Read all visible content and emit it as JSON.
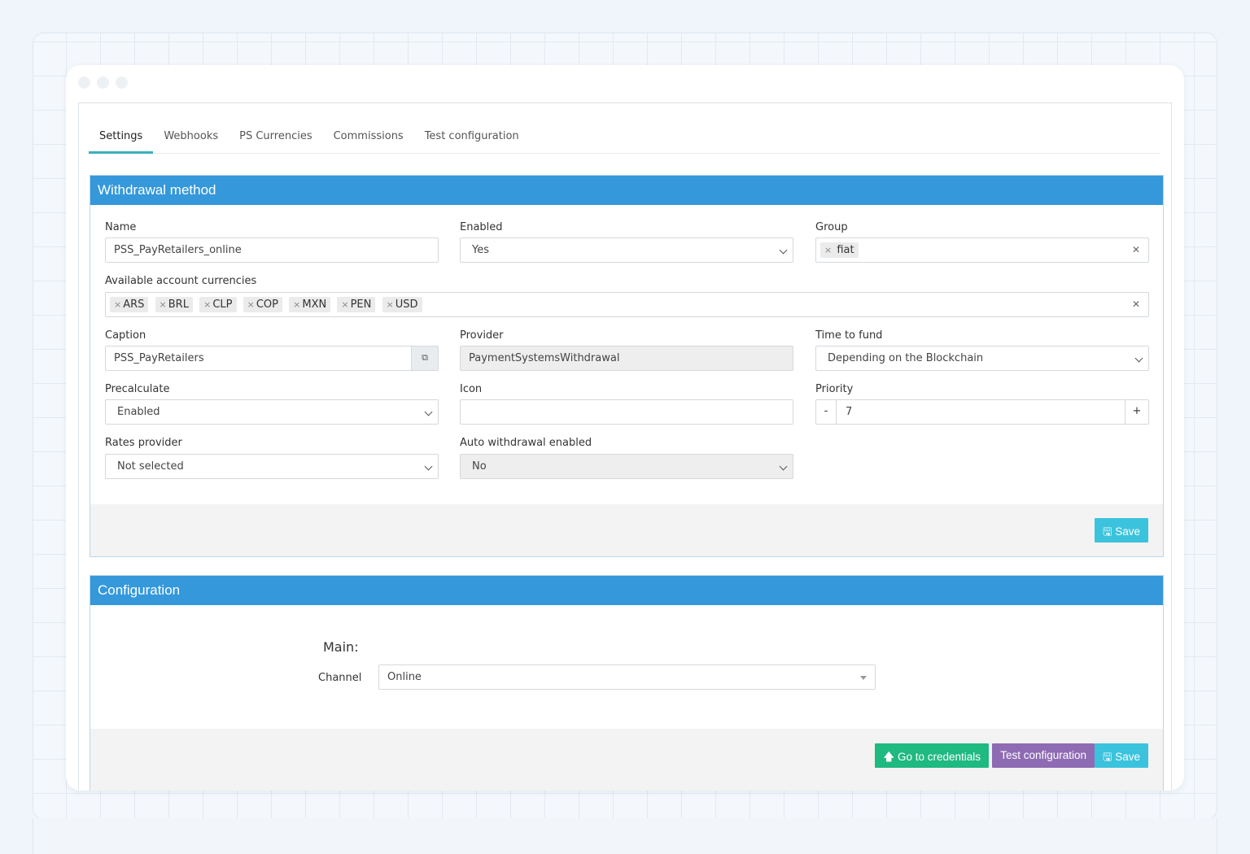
{
  "tabs": [
    {
      "label": "Settings"
    },
    {
      "label": "Webhooks"
    },
    {
      "label": "PS Currencies"
    },
    {
      "label": "Commissions"
    },
    {
      "label": "Test configuration"
    }
  ],
  "withdrawal": {
    "title": "Withdrawal method",
    "name_label": "Name",
    "name_value": "PSS_PayRetailers_online",
    "enabled_label": "Enabled",
    "enabled_value": "Yes",
    "group_label": "Group",
    "group_tags": [
      "fiat"
    ],
    "currencies_label": "Available account currencies",
    "currency_tags": [
      "ARS",
      "BRL",
      "CLP",
      "COP",
      "MXN",
      "PEN",
      "USD"
    ],
    "caption_label": "Caption",
    "caption_value": "PSS_PayRetailers",
    "provider_label": "Provider",
    "provider_value": "PaymentSystemsWithdrawal",
    "time_to_fund_label": "Time to fund",
    "time_to_fund_value": "Depending on the Blockchain",
    "precalculate_label": "Precalculate",
    "precalculate_value": "Enabled",
    "icon_label": "Icon",
    "icon_value": "",
    "priority_label": "Priority",
    "priority_value": "7",
    "priority_minus": "-",
    "priority_plus": "+",
    "rates_label": "Rates provider",
    "rates_value": "Not selected",
    "auto_label": "Auto withdrawal enabled",
    "auto_value": "No",
    "save_label": "Save",
    "tag_remove_glyph": "×"
  },
  "configuration": {
    "title": "Configuration",
    "section_title": "Main:",
    "channel_label": "Channel",
    "channel_value": "Online",
    "go_credentials_label": "Go to credentials",
    "test_config_label": "Test configuration",
    "save_label": "Save"
  },
  "colors": {
    "panel_header": "#3498db",
    "save_button": "#3bc3dd",
    "credentials_button": "#1fb982",
    "test_button": "#8e6bb3",
    "active_tab_underline": "#3aafc0"
  },
  "icons": [
    "copy-icon",
    "save-icon",
    "arrow-up-icon",
    "chevron-down-icon",
    "clear-icon"
  ]
}
